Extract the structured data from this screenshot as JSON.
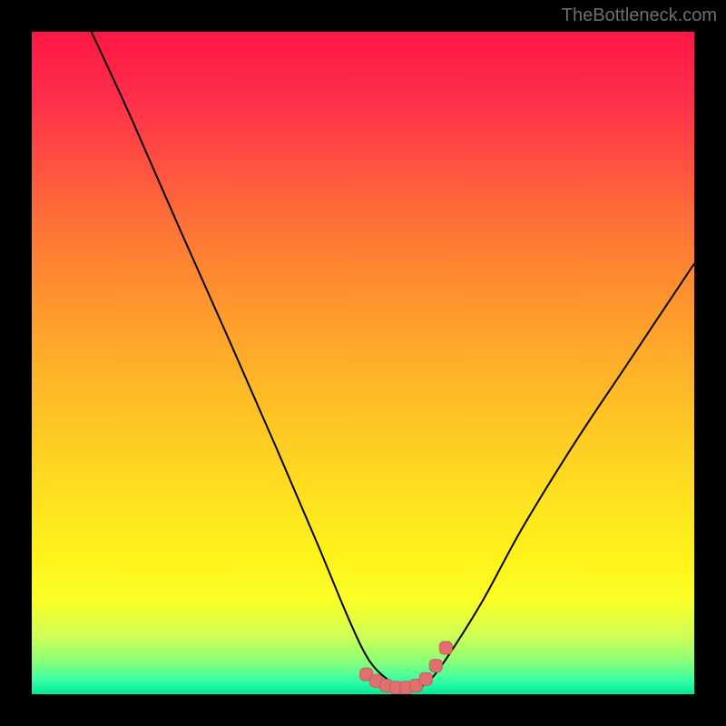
{
  "watermark": "TheBottleneck.com",
  "colors": {
    "frame": "#000000",
    "curve": "#000000",
    "marker_fill": "#e07070",
    "marker_stroke": "#c95c5c"
  },
  "chart_data": {
    "type": "line",
    "title": "",
    "xlabel": "",
    "ylabel": "",
    "xlim": [
      0,
      100
    ],
    "ylim": [
      0,
      100
    ],
    "grid": false,
    "series": [
      {
        "name": "bottleneck-curve",
        "x": [
          9,
          15,
          22,
          30,
          37,
          43,
          48,
          51,
          54,
          56,
          58,
          60,
          63,
          68,
          74,
          82,
          90,
          100
        ],
        "y": [
          100,
          87,
          71,
          53,
          37,
          23,
          11,
          5,
          2,
          1,
          1,
          2,
          6,
          14,
          25,
          38,
          50,
          65
        ]
      }
    ],
    "markers": {
      "name": "highlight-band",
      "x": [
        50.5,
        52,
        53.5,
        55,
        56.5,
        58,
        59.5,
        61,
        62.5
      ],
      "y": [
        3.0,
        2.0,
        1.3,
        1.0,
        1.0,
        1.3,
        2.3,
        4.3,
        7.0
      ]
    },
    "gradient_stops": [
      {
        "pct": 0,
        "hex": "#ff1744"
      },
      {
        "pct": 10,
        "hex": "#ff2e4a"
      },
      {
        "pct": 20,
        "hex": "#ff5140"
      },
      {
        "pct": 30,
        "hex": "#ff7536"
      },
      {
        "pct": 40,
        "hex": "#ff932e"
      },
      {
        "pct": 50,
        "hex": "#ffaf29"
      },
      {
        "pct": 60,
        "hex": "#ffc824"
      },
      {
        "pct": 70,
        "hex": "#ffe020"
      },
      {
        "pct": 80,
        "hex": "#fff41b"
      },
      {
        "pct": 86,
        "hex": "#f9ff27"
      },
      {
        "pct": 91,
        "hex": "#d2ff53"
      },
      {
        "pct": 95,
        "hex": "#8bff77"
      },
      {
        "pct": 98,
        "hex": "#35ffa7"
      },
      {
        "pct": 100,
        "hex": "#00e894"
      }
    ]
  }
}
